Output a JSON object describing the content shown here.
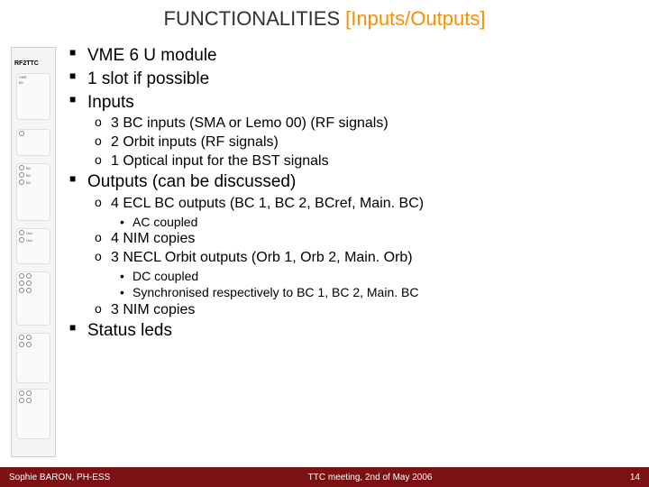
{
  "title": {
    "main": "FUNCTIONALITIES",
    "accent": "[Inputs/Outputs]"
  },
  "module": {
    "label": "RF2TTC"
  },
  "bullets": {
    "b1": "VME 6 U module",
    "b2": "1 slot if possible",
    "b3": "Inputs",
    "b3_1": "3 BC inputs (SMA or Lemo 00) (RF signals)",
    "b3_2": "2 Orbit inputs (RF signals)",
    "b3_3": "1 Optical input for the BST signals",
    "b4": "Outputs (can be discussed)",
    "b4_1": "4 ECL BC outputs (BC 1, BC 2, BCref, Main. BC)",
    "b4_1_1": "AC coupled",
    "b4_2": "4 NIM copies",
    "b4_3": "3 NECL Orbit outputs (Orb 1, Orb 2, Main. Orb)",
    "b4_3_1": "DC coupled",
    "b4_3_2": "Synchronised respectively to BC 1, BC 2, Main. BC",
    "b4_4": "3 NIM copies",
    "b5": "Status leds"
  },
  "footer": {
    "left": "Sophie BARON, PH-ESS",
    "center": "TTC meeting, 2nd of May 2006",
    "right": "14"
  }
}
